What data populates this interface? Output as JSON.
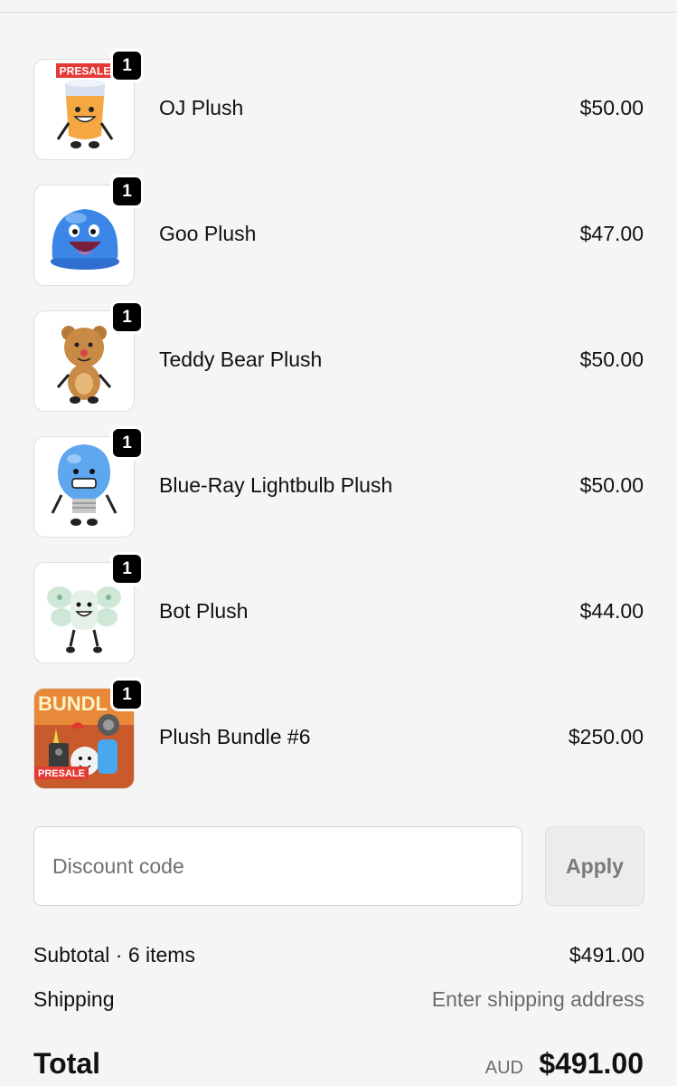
{
  "items": [
    {
      "name": "OJ Plush",
      "price": "$50.00",
      "quantity": "1",
      "image": "oj-plush-image",
      "badge": "PRESALE"
    },
    {
      "name": "Goo Plush",
      "price": "$47.00",
      "quantity": "1",
      "image": "goo-plush-image"
    },
    {
      "name": "Teddy Bear Plush",
      "price": "$50.00",
      "quantity": "1",
      "image": "teddy-bear-plush-image"
    },
    {
      "name": "Blue-Ray Lightbulb Plush",
      "price": "$50.00",
      "quantity": "1",
      "image": "lightbulb-plush-image"
    },
    {
      "name": "Bot Plush",
      "price": "$44.00",
      "quantity": "1",
      "image": "bot-plush-image"
    },
    {
      "name": "Plush Bundle #6",
      "price": "$250.00",
      "quantity": "1",
      "image": "bundle-image",
      "badge": "PRESALE",
      "banner": "BUNDL"
    }
  ],
  "discount": {
    "placeholder": "Discount code",
    "value": "",
    "apply_label": "Apply"
  },
  "summary": {
    "subtotal_label": "Subtotal · 6 items",
    "subtotal_value": "$491.00",
    "shipping_label": "Shipping",
    "shipping_value": "Enter shipping address",
    "total_label": "Total",
    "total_currency": "AUD",
    "total_value": "$491.00"
  },
  "colors": {
    "background": "#f5f5f5",
    "badge": "#000000",
    "presale_red": "#e53935",
    "muted_text": "#6b6b6b"
  }
}
